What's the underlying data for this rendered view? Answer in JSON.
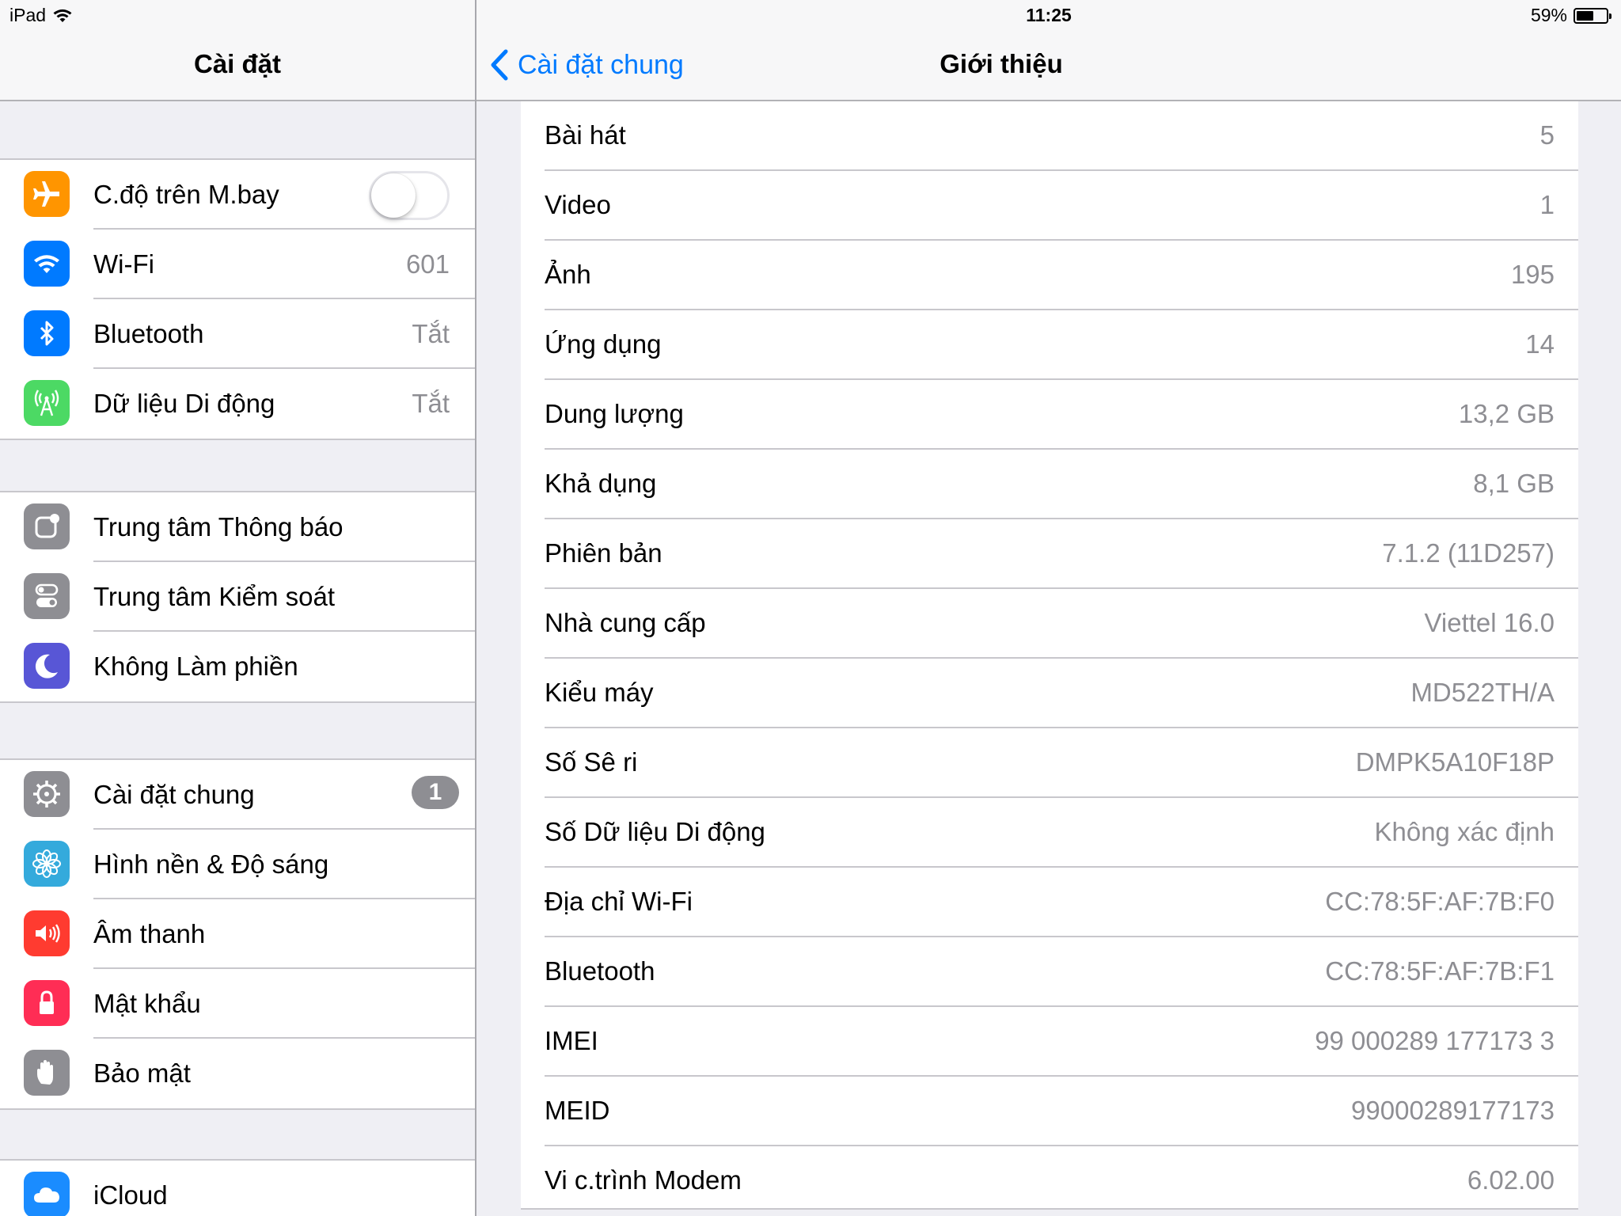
{
  "status_bar": {
    "device": "iPad",
    "time": "11:25",
    "battery": "59%",
    "battery_level": 0.59
  },
  "master": {
    "title": "Cài đặt",
    "groups": [
      {
        "items": [
          {
            "label": "C.độ trên M.bay",
            "icon": "airplane-icon",
            "color": "#ff9500",
            "toggle": false
          },
          {
            "label": "Wi-Fi",
            "icon": "wifi-icon",
            "color": "#007aff",
            "value": "601"
          },
          {
            "label": "Bluetooth",
            "icon": "bluetooth-icon",
            "color": "#007aff",
            "value": "Tắt"
          },
          {
            "label": "Dữ liệu Di động",
            "icon": "cellular-icon",
            "color": "#4cd964",
            "value": "Tắt"
          }
        ]
      },
      {
        "items": [
          {
            "label": "Trung tâm Thông báo",
            "icon": "notification-center-icon",
            "color": "#8e8e93"
          },
          {
            "label": "Trung tâm Kiểm soát",
            "icon": "control-center-icon",
            "color": "#8e8e93"
          },
          {
            "label": "Không Làm phiền",
            "icon": "moon-icon",
            "color": "#5856d6"
          }
        ]
      },
      {
        "items": [
          {
            "label": "Cài đặt chung",
            "icon": "gear-icon",
            "color": "#8e8e93",
            "badge": "1"
          },
          {
            "label": "Hình nền & Độ sáng",
            "icon": "flower-icon",
            "color": "#34aadc"
          },
          {
            "label": "Âm thanh",
            "icon": "speaker-icon",
            "color": "#ff3b30"
          },
          {
            "label": "Mật khẩu",
            "icon": "lock-icon",
            "color": "#ff2d55"
          },
          {
            "label": "Bảo mật",
            "icon": "hand-icon",
            "color": "#8e8e93"
          }
        ]
      },
      {
        "items": [
          {
            "label": "iCloud",
            "icon": "cloud-icon",
            "color": "#1a8cff"
          }
        ]
      }
    ]
  },
  "detail": {
    "back_label": "Cài đặt chung",
    "title": "Giới thiệu",
    "rows": [
      {
        "label": "Bài hát",
        "value": "5"
      },
      {
        "label": "Video",
        "value": "1"
      },
      {
        "label": "Ảnh",
        "value": "195"
      },
      {
        "label": "Ứng dụng",
        "value": "14"
      },
      {
        "label": "Dung lượng",
        "value": "13,2 GB"
      },
      {
        "label": "Khả dụng",
        "value": "8,1 GB"
      },
      {
        "label": "Phiên bản",
        "value": "7.1.2 (11D257)"
      },
      {
        "label": "Nhà cung cấp",
        "value": "Viettel 16.0"
      },
      {
        "label": "Kiểu máy",
        "value": "MD522TH/A"
      },
      {
        "label": "Số Sê ri",
        "value": "DMPK5A10F18P"
      },
      {
        "label": "Số Dữ liệu Di động",
        "value": "Không xác định"
      },
      {
        "label": "Địa chỉ Wi-Fi",
        "value": "CC:78:5F:AF:7B:F0"
      },
      {
        "label": "Bluetooth",
        "value": "CC:78:5F:AF:7B:F1"
      },
      {
        "label": "IMEI",
        "value": "99 000289 177173 3"
      },
      {
        "label": "MEID",
        "value": "99000289177173"
      },
      {
        "label": "Vi c.trình Modem",
        "value": "6.02.00"
      }
    ]
  }
}
